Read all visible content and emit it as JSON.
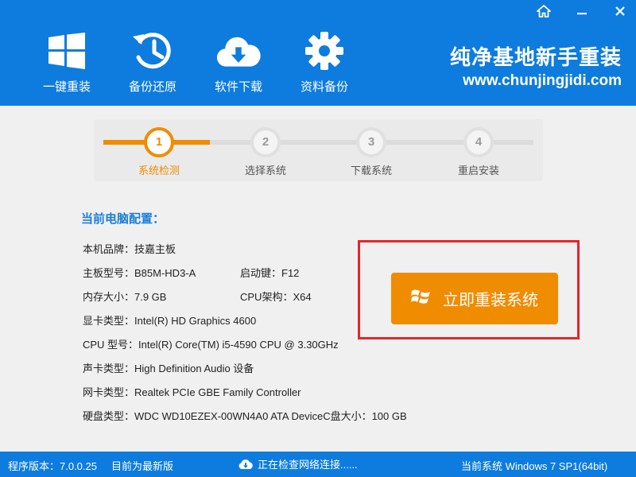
{
  "header": {
    "nav": [
      {
        "label": "一键重装",
        "icon": "windows-logo-icon"
      },
      {
        "label": "备份还原",
        "icon": "history-clock-icon"
      },
      {
        "label": "软件下载",
        "icon": "cloud-download-icon"
      },
      {
        "label": "资料备份",
        "icon": "gear-icon"
      }
    ],
    "brand_title": "纯净基地新手重装",
    "brand_url": "www.chunjingjidi.com",
    "controls": {
      "home_icon": "home-icon",
      "minimize_icon": "minimize-icon",
      "close_icon": "close-icon"
    }
  },
  "steps": [
    {
      "number": "1",
      "label": "系统检测",
      "active": true
    },
    {
      "number": "2",
      "label": "选择系统",
      "active": false
    },
    {
      "number": "3",
      "label": "下载系统",
      "active": false
    },
    {
      "number": "4",
      "label": "重启安装",
      "active": false
    }
  ],
  "config": {
    "title": "当前电脑配置：",
    "brand": "本机品牌：技嘉主板",
    "board": "主板型号：B85M-HD3-A",
    "boot_key": "启动键：F12",
    "memory": "内存大小：7.9 GB",
    "cpu_arch": "CPU架构：X64",
    "gpu": "显卡类型：Intel(R) HD Graphics 4600",
    "cpu": "CPU 型号：Intel(R) Core(TM) i5-4590 CPU @ 3.30GHz",
    "audio": "声卡类型：High Definition Audio 设备",
    "network": "网卡类型：Realtek PCIe GBE Family Controller",
    "disk": "硬盘类型：WDC WD10EZEX-00WN4A0 ATA Device",
    "c_drive": "C盘大小：100 GB"
  },
  "action": {
    "reinstall_label": "立即重装系统"
  },
  "status": {
    "version": "程序版本：7.0.0.25",
    "latest": "目前为最新版",
    "network": "正在检查网络连接......",
    "current_system": "当前系统 Windows 7 SP1(64bit)"
  },
  "colors": {
    "primary": "#0d7cde",
    "accent": "#f08c00",
    "highlight": "#e8232a",
    "title": "#1a7fdc"
  }
}
